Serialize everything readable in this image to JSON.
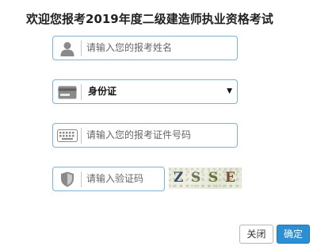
{
  "title": "欢迎您报考2019年度二级建造师执业资格考试",
  "fields": {
    "name": {
      "placeholder": "请输入您的报考姓名",
      "icon": "user-icon"
    },
    "id_type": {
      "selected": "身份证",
      "icon": "card-icon"
    },
    "id_number": {
      "placeholder": "请输入您的报考证件号码",
      "icon": "keyboard-icon"
    },
    "captcha": {
      "placeholder": "请输入验证码",
      "icon": "shield-icon"
    }
  },
  "captcha_image": {
    "chars": [
      {
        "ch": "Z",
        "color": "#3d4f64"
      },
      {
        "ch": "S",
        "color": "#6b7550"
      },
      {
        "ch": "S",
        "color": "#6a6f3a"
      },
      {
        "ch": "E",
        "color": "#7a4a2a"
      }
    ]
  },
  "buttons": {
    "close": "关闭",
    "confirm": "确定"
  },
  "colors": {
    "border": "#7fb2d6",
    "primary": "#2c8fd4"
  }
}
